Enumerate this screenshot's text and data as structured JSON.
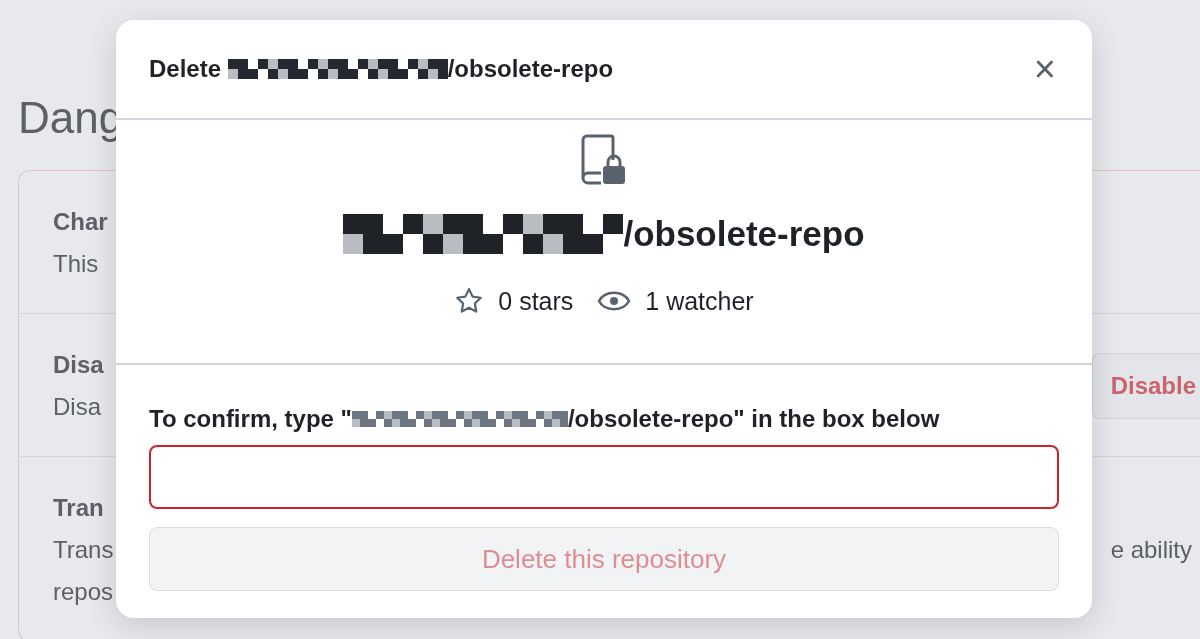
{
  "page": {
    "heading": "Dang",
    "danger_items": [
      {
        "title": "Char",
        "description_lines": [
          "This"
        ]
      },
      {
        "title": "Disa",
        "description_lines": [
          "Disa"
        ],
        "button": "Disable"
      },
      {
        "title": "Tran",
        "description_lines": [
          "Trans",
          "repos"
        ],
        "description_tail": "e ability"
      }
    ]
  },
  "dialog": {
    "title": [
      {
        "kind": "text",
        "text": "Delete "
      },
      {
        "kind": "redacted"
      },
      {
        "kind": "text",
        "text": "/obsolete-repo"
      }
    ],
    "close": "×",
    "repo_name": [
      {
        "kind": "redacted"
      },
      {
        "kind": "text",
        "text": "/obsolete-repo"
      }
    ],
    "stats": [
      {
        "kind": "stars",
        "text": "0 stars"
      },
      {
        "kind": "watchers",
        "text": "1 watcher"
      }
    ],
    "confirm_label": [
      {
        "kind": "text",
        "text": "To confirm, type \""
      },
      {
        "kind": "redacted"
      },
      {
        "kind": "text",
        "text": "/obsolete-repo\" in the box below"
      }
    ],
    "input": {
      "invalid": true
    },
    "delete_button": {
      "label": "Delete this repository",
      "disabled": true
    }
  }
}
